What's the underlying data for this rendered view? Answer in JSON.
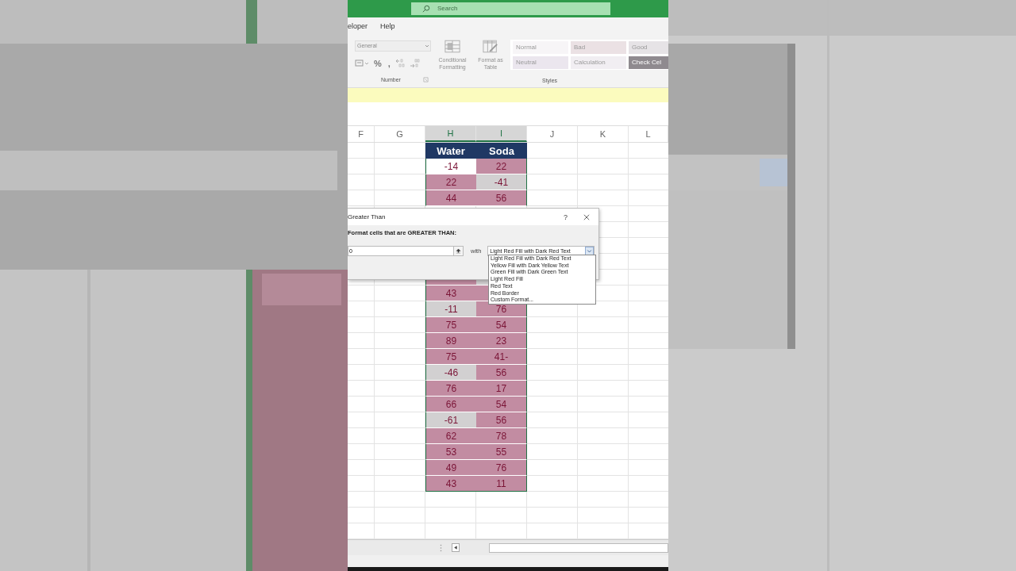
{
  "search": {
    "placeholder": "Search"
  },
  "tabs": [
    {
      "label": "eloper",
      "selected": false
    },
    {
      "label": "Help",
      "selected": false
    }
  ],
  "ribbon": {
    "number_group": {
      "format_box": "General",
      "buttons": [
        "%",
        ","
      ],
      "label": "Number"
    },
    "styles_group": {
      "buttons": [
        {
          "label": "Conditional Formatting"
        },
        {
          "label": "Format as Table"
        }
      ],
      "styles": [
        {
          "label": "Normal",
          "color": "#f7f5f7"
        },
        {
          "label": "Bad",
          "color": "#ebe1e4"
        },
        {
          "label": "Good",
          "color": "#e6e3e6"
        },
        {
          "label": "Neutral",
          "color": "#ebe6ee"
        },
        {
          "label": "Calculation",
          "color": "#f1eef2"
        },
        {
          "label": "Check Cel",
          "color": "#8f8a8f"
        }
      ],
      "label": "Styles"
    }
  },
  "columns": [
    {
      "label": "F",
      "selected": false
    },
    {
      "label": "G",
      "selected": false
    },
    {
      "label": "H",
      "selected": true
    },
    {
      "label": "I",
      "selected": true
    },
    {
      "label": "J",
      "selected": false
    },
    {
      "label": "K",
      "selected": false
    },
    {
      "label": "L",
      "selected": false
    }
  ],
  "table": {
    "headers": [
      "Water",
      "Soda"
    ],
    "rows": [
      [
        {
          "text": "-14",
          "color": "#ffffff"
        },
        {
          "text": "22",
          "color": "#c28ca2"
        }
      ],
      [
        {
          "text": "22",
          "color": "#c28ca2"
        },
        {
          "text": "-41",
          "color": "#d2d0d1"
        }
      ],
      [
        {
          "text": "44",
          "color": "#c28ca2"
        },
        {
          "text": "56",
          "color": "#c28ca2"
        }
      ],
      [
        {
          "color": "#c28ca2"
        },
        {
          "color": "#d2d0d1"
        }
      ],
      [
        {
          "text": "43",
          "color": "#c28ca2"
        },
        {
          "color": "#c28ca2"
        }
      ],
      [
        {
          "text": "-11",
          "color": "#d2d0d1"
        },
        {
          "text": "76",
          "color": "#c28ca2"
        }
      ],
      [
        {
          "text": "75",
          "color": "#c28ca2"
        },
        {
          "text": "54",
          "color": "#c28ca2"
        }
      ],
      [
        {
          "text": "89",
          "color": "#c28ca2"
        },
        {
          "text": "23",
          "color": "#c28ca2"
        }
      ],
      [
        {
          "text": "75",
          "color": "#c28ca2"
        },
        {
          "text": "41-",
          "color": "#c28ca2"
        }
      ],
      [
        {
          "text": "-46",
          "color": "#d2d0d1"
        },
        {
          "text": "56",
          "color": "#c28ca2"
        }
      ],
      [
        {
          "text": "76",
          "color": "#c28ca2"
        },
        {
          "text": "17",
          "color": "#c28ca2"
        }
      ],
      [
        {
          "text": "66",
          "color": "#c28ca2"
        },
        {
          "text": "54",
          "color": "#c28ca2"
        }
      ],
      [
        {
          "text": "-61",
          "color": "#d2d0d1"
        },
        {
          "text": "56",
          "color": "#c28ca2"
        }
      ],
      [
        {
          "text": "62",
          "color": "#c28ca2"
        },
        {
          "text": "78",
          "color": "#c28ca2"
        }
      ],
      [
        {
          "text": "53",
          "color": "#c28ca2"
        },
        {
          "text": "55",
          "color": "#c28ca2"
        }
      ],
      [
        {
          "text": "49",
          "color": "#c28ca2"
        },
        {
          "text": "76",
          "color": "#c28ca2"
        }
      ],
      [
        {
          "text": "43",
          "color": "#c28ca2"
        },
        {
          "text": "11",
          "color": "#c28ca2"
        }
      ]
    ]
  },
  "dialog": {
    "title": "Greater Than",
    "help": "?",
    "prompt": "Format cells that are GREATER THAN:",
    "value": "0",
    "with_label": "with",
    "format": "Light Red Fill with Dark Red Text",
    "options": [
      "Light Red Fill with Dark Red Text",
      "Yellow Fill with Dark Yellow Text",
      "Green Fill with Dark Green Text",
      "Light Red Fill",
      "Red Text",
      "Red Border",
      "Custom Format..."
    ]
  }
}
